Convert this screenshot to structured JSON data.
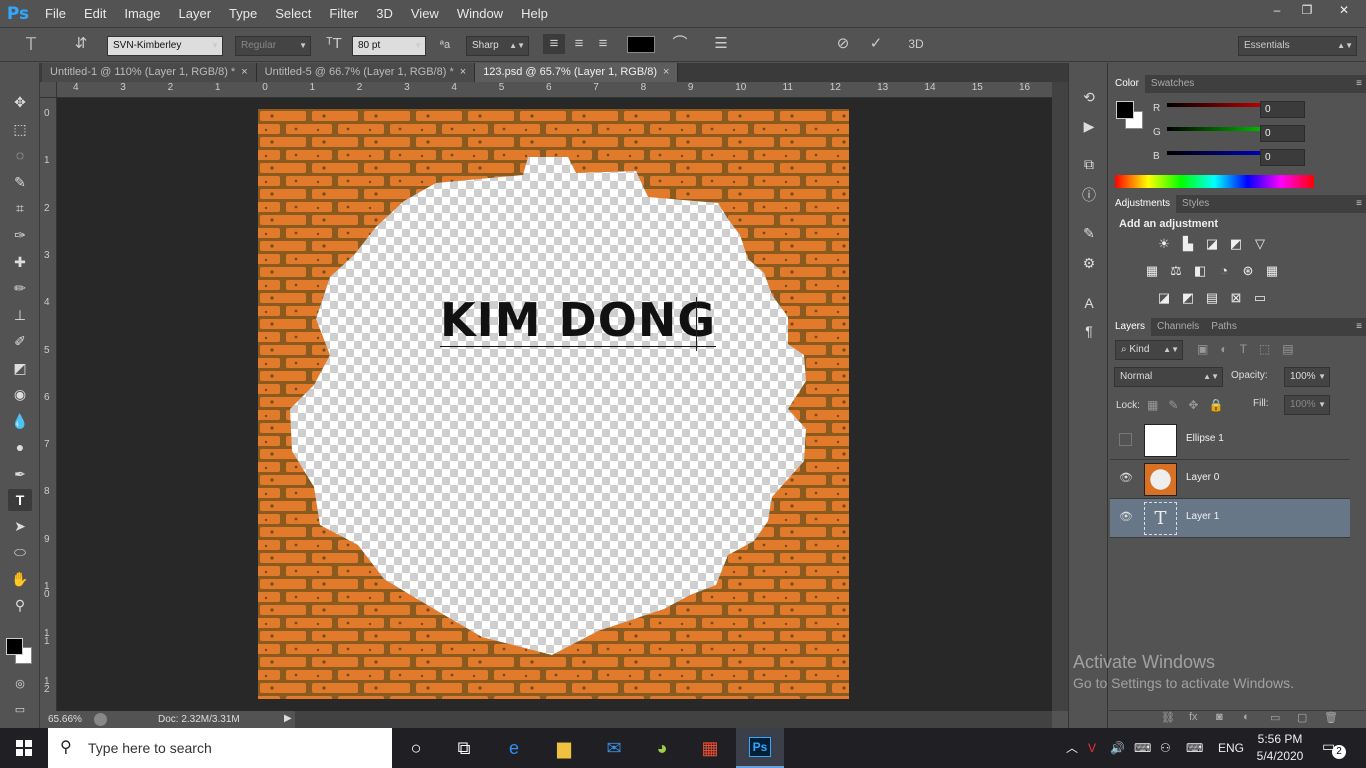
{
  "app": {
    "logo": "Ps"
  },
  "menu": [
    "File",
    "Edit",
    "Image",
    "Layer",
    "Type",
    "Select",
    "Filter",
    "3D",
    "View",
    "Window",
    "Help"
  ],
  "window_controls": {
    "minimize": "–",
    "restore": "❐",
    "close": "✕"
  },
  "options": {
    "font_family": "SVN-Kimberley",
    "font_style": "Regular",
    "font_size": "80 pt",
    "aa_label": "ªa",
    "antialias": "Sharp",
    "text_color": "#000000",
    "workspace": "Essentials"
  },
  "tabs": [
    {
      "label": "Untitled-1 @ 110% (Layer 1, RGB/8) *",
      "close": "×"
    },
    {
      "label": "Untitled-5 @ 66.7% (Layer 1, RGB/8) *",
      "close": "×"
    },
    {
      "label": "123.psd @ 65.7% (Layer 1, RGB/8)",
      "close": "×"
    }
  ],
  "ruler_top": [
    "4",
    "3",
    "2",
    "1",
    "0",
    "1",
    "2",
    "3",
    "4",
    "5",
    "6",
    "7",
    "8",
    "9",
    "10",
    "11",
    "12",
    "13",
    "14",
    "15",
    "16"
  ],
  "ruler_left": [
    "0",
    "1",
    "2",
    "3",
    "4",
    "5",
    "6",
    "7",
    "8",
    "9",
    "1\n0",
    "1\n1",
    "1\n2"
  ],
  "canvas": {
    "text": "KIM DONG",
    "brick_color": "#e27a2b",
    "mortar_color": "#8a5a1e"
  },
  "status": {
    "zoom": "65.66%",
    "doc": "Doc: 2.32M/3.31M"
  },
  "color_panel": {
    "tabs": [
      "Color",
      "Swatches"
    ],
    "channels": [
      {
        "label": "R",
        "value": "0",
        "color": "#ff0000"
      },
      {
        "label": "G",
        "value": "0",
        "color": "#00ff00"
      },
      {
        "label": "B",
        "value": "0",
        "color": "#0000ff"
      }
    ]
  },
  "adjustments": {
    "tabs": [
      "Adjustments",
      "Styles"
    ],
    "heading": "Add an adjustment"
  },
  "layers_panel": {
    "tabs": [
      "Layers",
      "Channels",
      "Paths"
    ],
    "filter_kind": "Kind",
    "blend_mode": "Normal",
    "opacity_label": "Opacity:",
    "opacity": "100%",
    "lock_label": "Lock:",
    "fill_label": "Fill:",
    "fill": "100%",
    "layers": [
      {
        "name": "Ellipse 1",
        "visible": false
      },
      {
        "name": "Layer 0",
        "visible": true
      },
      {
        "name": "Layer 1",
        "visible": true,
        "selected": true,
        "thumb_text": "T"
      }
    ]
  },
  "watermark": {
    "line1": "Activate Windows",
    "line2": "Go to Settings to activate Windows."
  },
  "taskbar": {
    "search_placeholder": "Type here to search",
    "apps": [
      "task-view",
      "edge",
      "file-explorer",
      "mail",
      "greenshot",
      "store",
      "photoshop"
    ],
    "ps_label": "Ps",
    "language": "ENG",
    "time": "5:56 PM",
    "date": "5/4/2020",
    "notifications": "2"
  }
}
